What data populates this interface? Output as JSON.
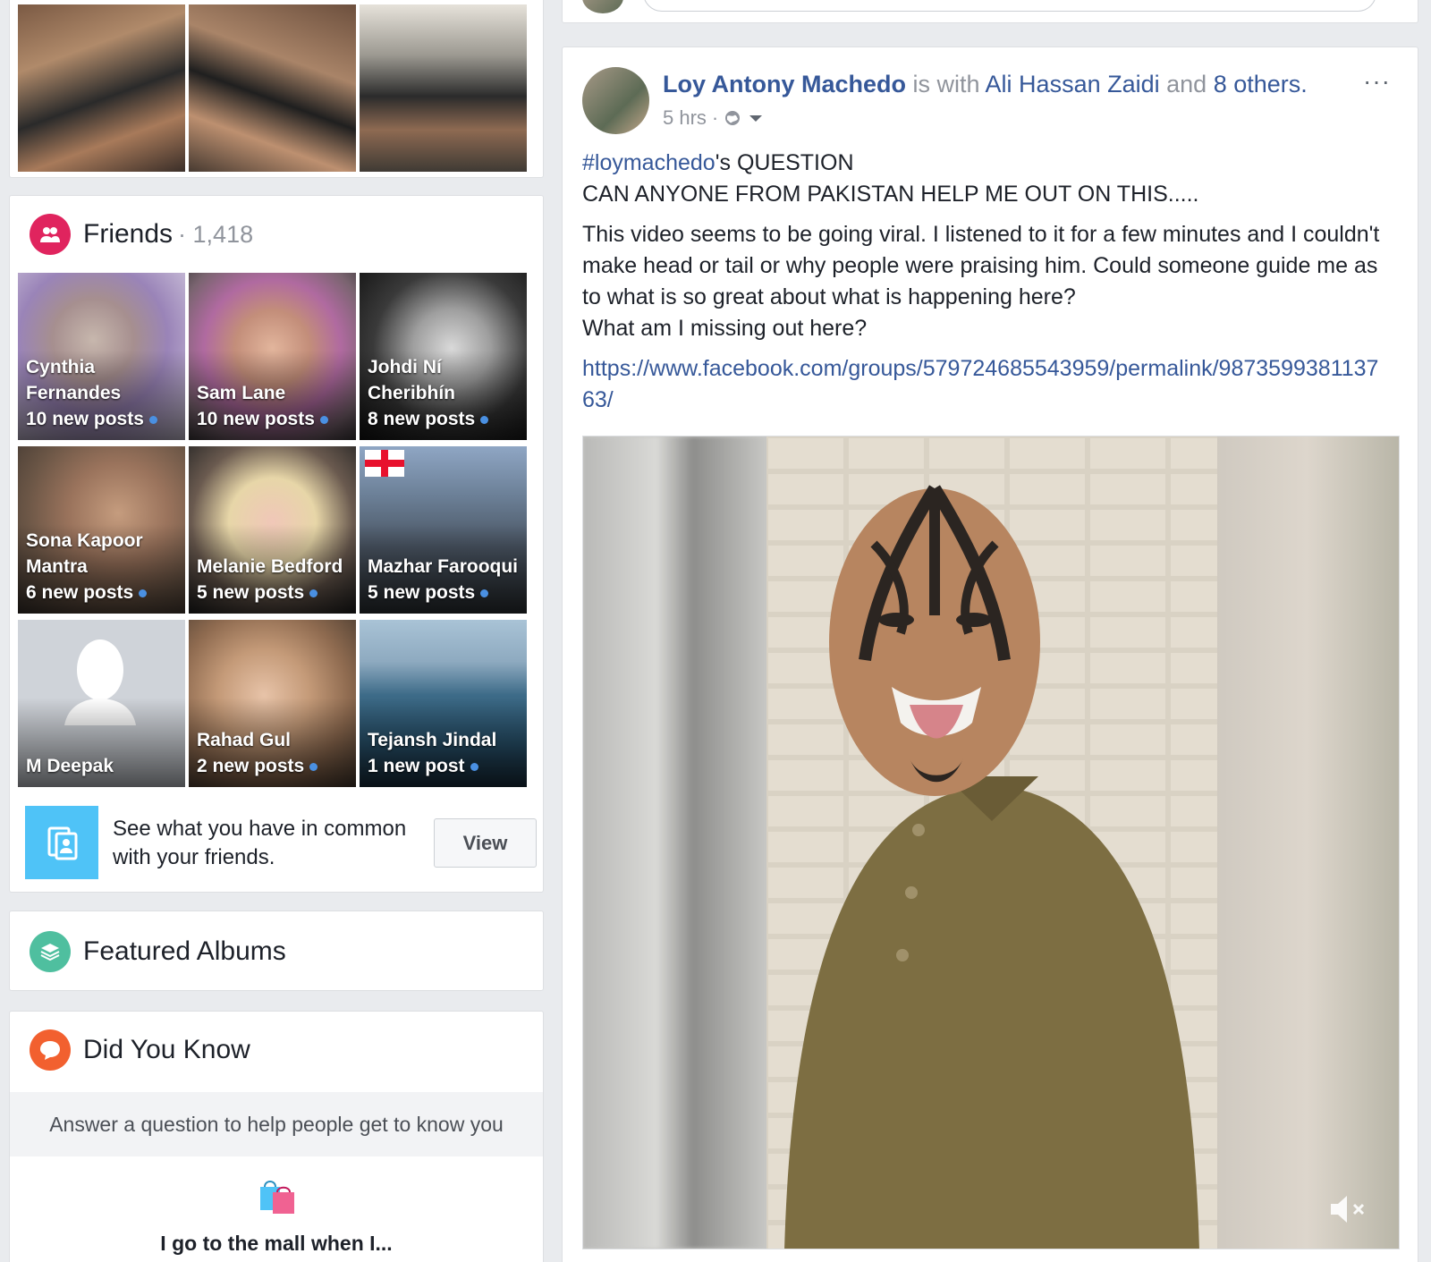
{
  "friends": {
    "title": "Friends",
    "count": "· 1,418",
    "tiles": [
      {
        "name": "Cynthia Fernandes",
        "posts": "10 new posts",
        "has_dot": true
      },
      {
        "name": "Sam Lane",
        "posts": "10 new posts",
        "has_dot": true
      },
      {
        "name": "Johdi Ní Cheribhín",
        "posts": "8 new posts",
        "has_dot": true
      },
      {
        "name": "Sona Kapoor Mantra",
        "posts": "6 new posts",
        "has_dot": true
      },
      {
        "name": "Melanie Bedford",
        "posts": "5 new posts",
        "has_dot": true
      },
      {
        "name": "Mazhar Farooqui",
        "posts": "5 new posts",
        "has_dot": true
      },
      {
        "name": "M Deepak",
        "posts": "",
        "has_dot": false
      },
      {
        "name": "Rahad Gul",
        "posts": "2 new posts",
        "has_dot": true
      },
      {
        "name": "Tejansh Jindal",
        "posts": "1 new post",
        "has_dot": true
      }
    ],
    "common_text": "See what you have in common with your friends.",
    "view_label": "View"
  },
  "featured_albums": {
    "title": "Featured Albums"
  },
  "did_you_know": {
    "title": "Did You Know",
    "question_bar": "Answer a question to help people get to know you",
    "prompt": "I go to the mall when I..."
  },
  "post": {
    "author": "Loy Antony Machedo",
    "with_text": " is with ",
    "tagged": "Ali Hassan Zaidi",
    "and_text": " and ",
    "others": "8 others.",
    "time": "5 hrs",
    "more": "···",
    "hashtag": "#loymachedo",
    "question_suffix": "'s QUESTION",
    "line2": "CAN ANYONE FROM PAKISTAN HELP ME OUT ON THIS.....",
    "para1": "This video seems to be going viral. I listened to it for a few minutes and I couldn't make head or tail or why people were praising him. Could someone guide me as to what is so great about what is happening here?",
    "para2": "What am I missing out here?",
    "url": "https://www.facebook.com/groups/579724685543959/permalink/987359938113763/"
  },
  "colors": {
    "friends_icon": "#e0245e",
    "albums_icon": "#4fbf9f",
    "dyk_icon": "#f2602f",
    "link": "#365899"
  }
}
